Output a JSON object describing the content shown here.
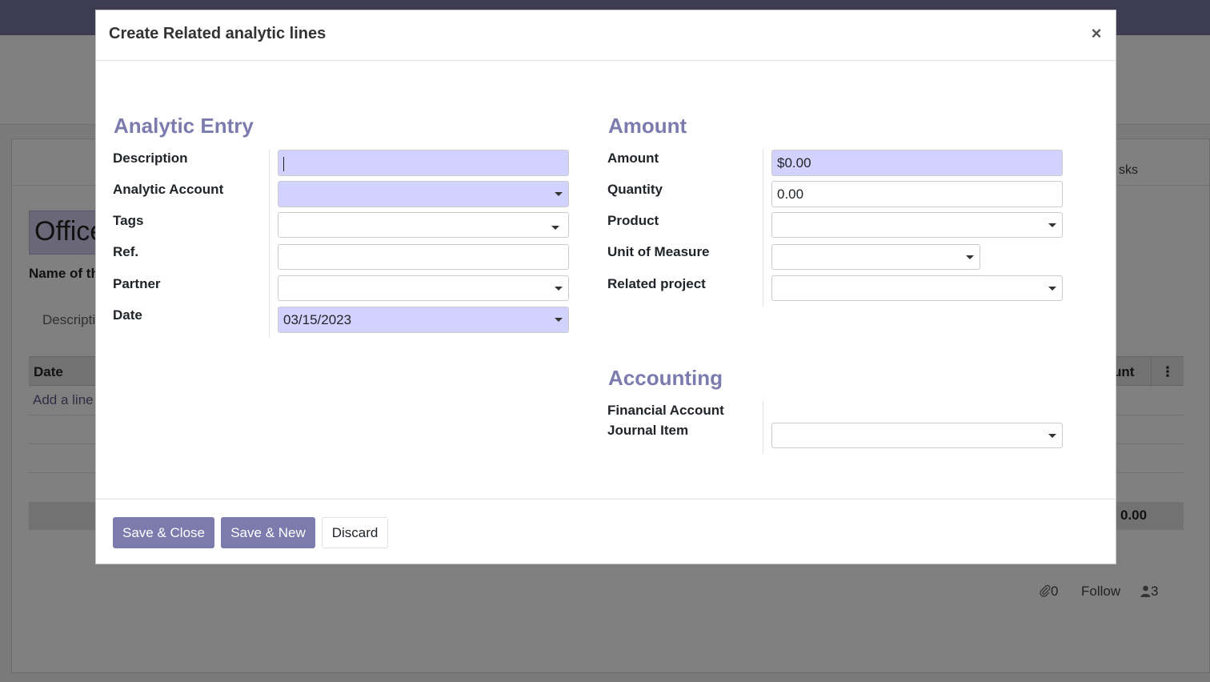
{
  "background": {
    "record_name": "Office",
    "name_label": "Name of th",
    "tab_description": "Descripti",
    "tab_tasks": "sks",
    "table": {
      "col_date": "Date",
      "col_amount": "unt",
      "menu_glyph": "⋮",
      "add_line": "Add a line",
      "total": "0.00"
    },
    "chatter": {
      "attachments_count": "0",
      "follow_label": "Follow",
      "followers_count": "3"
    }
  },
  "modal": {
    "title": "Create Related analytic lines",
    "close_glyph": "×",
    "analytic_entry": {
      "title": "Analytic Entry",
      "description": {
        "label": "Description",
        "value": ""
      },
      "analytic_account": {
        "label": "Analytic Account",
        "value": ""
      },
      "tags": {
        "label": "Tags",
        "value": ""
      },
      "ref": {
        "label": "Ref.",
        "value": ""
      },
      "partner": {
        "label": "Partner",
        "value": ""
      },
      "date": {
        "label": "Date",
        "value": "03/15/2023"
      }
    },
    "amount_group": {
      "title": "Amount",
      "amount": {
        "label": "Amount",
        "value": "$0.00"
      },
      "quantity": {
        "label": "Quantity",
        "value": "0.00"
      },
      "product": {
        "label": "Product",
        "value": ""
      },
      "uom": {
        "label": "Unit of Measure",
        "value": ""
      },
      "project": {
        "label": "Related project",
        "value": ""
      }
    },
    "accounting": {
      "title": "Accounting",
      "fin_label_line1": "Financial Account",
      "fin_label_line2": "Journal Item",
      "fin_value": ""
    },
    "footer": {
      "save_close": "Save & Close",
      "save_new": "Save & New",
      "discard": "Discard"
    }
  },
  "colors": {
    "brand": "#7c7bad",
    "required_field": "#d2d2ff",
    "topbar": "#3e3c53"
  }
}
